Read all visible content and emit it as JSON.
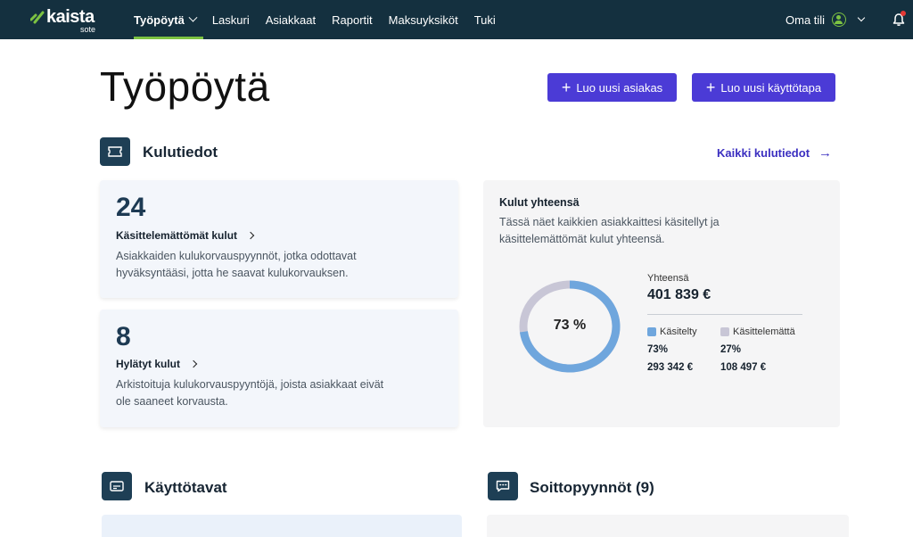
{
  "brand": {
    "name": "kaista",
    "sub": "sote"
  },
  "nav": {
    "items": [
      {
        "label": "Työpöytä",
        "active": true
      },
      {
        "label": "Laskuri"
      },
      {
        "label": "Asiakkaat"
      },
      {
        "label": "Raportit"
      },
      {
        "label": "Maksuyksiköt"
      },
      {
        "label": "Tuki"
      }
    ],
    "account_label": "Oma tili"
  },
  "page": {
    "title": "Työpöytä",
    "buttons": {
      "new_client": "Luo uusi asiakas",
      "new_method": "Luo uusi käyttötapa"
    }
  },
  "expenses": {
    "title": "Kulutiedot",
    "all_link": "Kaikki kulutiedot",
    "unprocessed": {
      "count": "24",
      "label": "Käsittelemättömät kulut",
      "desc": "Asiakkaiden kulukorvauspyynnöt, jotka odottavat hyväksyntääsi, jotta he saavat kulukorvauksen."
    },
    "rejected": {
      "count": "8",
      "label": "Hylätyt kulut",
      "desc": "Arkistoituja kulukorvauspyyntöjä, joista asiakkaat eivät ole saaneet korvausta."
    },
    "totals": {
      "title": "Kulut yhteensä",
      "desc": "Tässä näet kaikkien asiakkaittesi käsitellyt ja käsittelemättömät kulut yhteensä.",
      "percent_label": "73 %",
      "processed_fraction": 0.73,
      "sum_label": "Yhteensä",
      "sum_value": "401 839 €",
      "processed": {
        "label": "Käsitelty",
        "percent": "73%",
        "amount": "293 342 €",
        "color": "#6fa6dd"
      },
      "unprocessed": {
        "label": "Käsittelemättä",
        "percent": "27%",
        "amount": "108 497 €",
        "color": "#c8c6d6"
      }
    }
  },
  "usage": {
    "title": "Käyttötavat"
  },
  "callbacks": {
    "title": "Soittopyynnöt (9)"
  },
  "colors": {
    "nav_bg": "#14303f",
    "accent": "#4b3bd6",
    "active_underline": "#7cc242"
  }
}
